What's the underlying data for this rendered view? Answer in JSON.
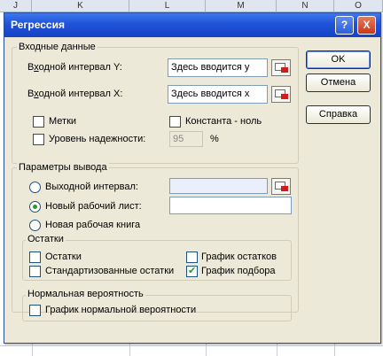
{
  "spreadsheet": {
    "columns": [
      "J",
      "K",
      "L",
      "M",
      "N",
      "O"
    ]
  },
  "dialog": {
    "title": "Регрессия",
    "help_button": "?",
    "close_button": "X",
    "input_group": {
      "legend": "Входные данные",
      "y_label_prefix": "В",
      "y_label_accel": "х",
      "y_label_rest": "одной интервал Y:",
      "y_value": "Здесь вводится у",
      "x_label_prefix": "В",
      "x_label_accel": "х",
      "x_label_rest": "одной интервал X:",
      "x_value": "Здесь вводится х",
      "labels_checkbox": "Метки",
      "labels_checked": false,
      "constant_zero_checkbox": "Константа - ноль",
      "constant_zero_checked": false,
      "confidence_checkbox": "Уровень надежности:",
      "confidence_checked": false,
      "confidence_value": "95",
      "confidence_unit": "%"
    },
    "output_group": {
      "legend": "Параметры вывода",
      "output_range_radio": "Выходной интервал:",
      "output_range_selected": false,
      "output_range_value": "",
      "new_sheet_radio": "Новый рабочий лист:",
      "new_sheet_selected": true,
      "new_sheet_value": "",
      "new_book_radio": "Новая рабочая книга",
      "new_book_selected": false
    },
    "residuals_group": {
      "legend": "Остатки",
      "residuals": "Остатки",
      "residuals_checked": false,
      "standardized_residuals": "Стандартизованные остатки",
      "standardized_residuals_checked": false,
      "residual_plots": "График остатков",
      "residual_plots_checked": false,
      "line_fit_plots": "График подбора",
      "line_fit_plots_checked": true
    },
    "normal_prob_group": {
      "legend": "Нормальная вероятность",
      "normal_plot": "График нормальной вероятности",
      "normal_plot_checked": false
    },
    "buttons": {
      "ok": "OK",
      "cancel": "Отмена",
      "help": "Справка"
    }
  }
}
